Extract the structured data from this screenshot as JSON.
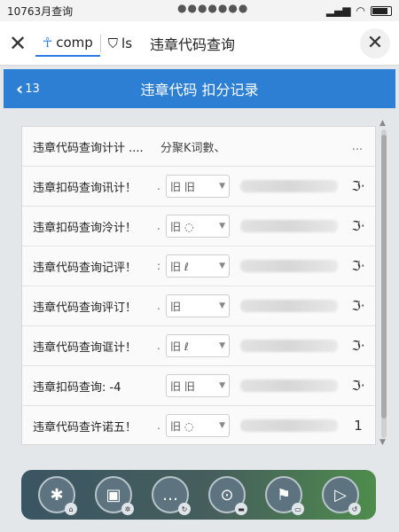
{
  "status_bar": {
    "time": "10763月查询",
    "dots": "●●●●●●●"
  },
  "browser": {
    "close_glyph": "✕",
    "tab1_label": "comp",
    "tab2_label": "ls",
    "title": "违章代码查询",
    "close_btn_glyph": "✕"
  },
  "header": {
    "back_label": "13",
    "title": "违章代码  扣分记录"
  },
  "list": {
    "first_row": {
      "label": "违章代码查询计计 ....",
      "hint": "分聚K词數、",
      "more": "..."
    },
    "rows": [
      {
        "label": "违章扣码查询讯计！",
        "dot": ".",
        "select": "旧 旧",
        "end": "ℑ·"
      },
      {
        "label": "违章扣码查询泠计！",
        "dot": ".",
        "select": "旧 ◌",
        "end": "ℑ·"
      },
      {
        "label": "违章代码查询记评！",
        "dot": ":",
        "select": "旧 ℓ",
        "end": "ℑ·"
      },
      {
        "label": "违章代码查询评订！",
        "dot": ".",
        "select": "旧",
        "end": "ℑ·"
      },
      {
        "label": "违章代码查询诓计！",
        "dot": ".",
        "select": "旧 ℓ",
        "end": "ℑ·"
      },
      {
        "label": "违章扣码查询: -4",
        "dot": "",
        "select": "旧 旧",
        "end": "ℑ·"
      },
      {
        "label": "违章代码查许诺五！",
        "dot": ".",
        "select": "旧 ◌",
        "end": "1"
      }
    ]
  },
  "dock": {
    "items": [
      {
        "glyph": "✱",
        "badge": "⌂"
      },
      {
        "glyph": "▣",
        "badge": "✲"
      },
      {
        "glyph": "…",
        "badge": "↻"
      },
      {
        "glyph": "⊙",
        "badge": "▬"
      },
      {
        "glyph": "⚑",
        "badge": "▭"
      },
      {
        "glyph": "▷",
        "badge": "↺"
      }
    ]
  }
}
